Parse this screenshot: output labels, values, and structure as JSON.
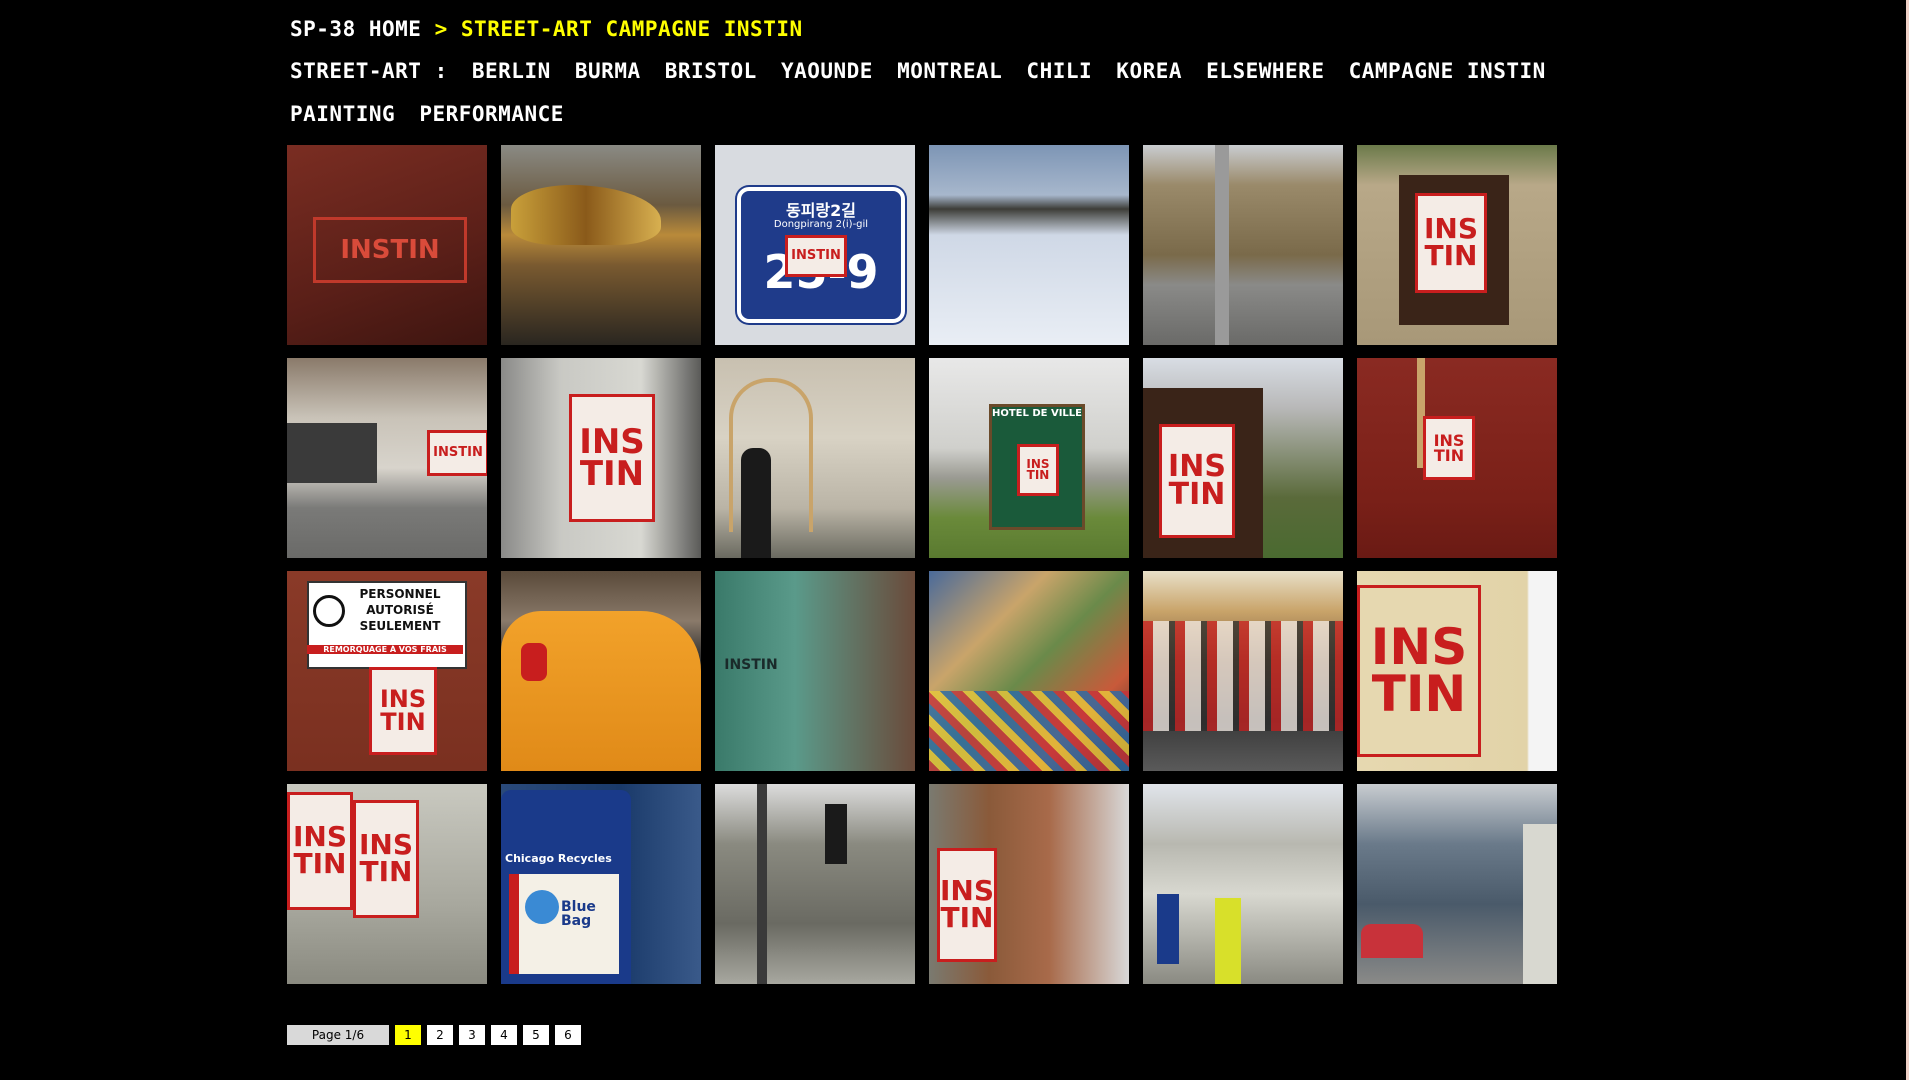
{
  "breadcrumb": {
    "home": "SP-38 HOME",
    "separator": ">",
    "current": "STREET-ART CAMPAGNE INSTIN"
  },
  "nav": {
    "prefix": "STREET-ART :",
    "links": [
      "BERLIN",
      "BURMA",
      "BRISTOL",
      "YAOUNDE",
      "MONTREAL",
      "CHILI",
      "KOREA",
      "ELSEWHERE",
      "CAMPAGNE INSTIN"
    ],
    "line2": [
      "PAINTING",
      "PERFORMANCE"
    ]
  },
  "thumbnails": [
    {
      "tag": "INSTIN"
    },
    {
      "tag": ""
    },
    {
      "tag": "INSTIN"
    },
    {
      "tag": ""
    },
    {
      "tag": ""
    },
    {
      "tag": "INS TIN"
    },
    {
      "tag": ""
    },
    {
      "tag": "INS TIN"
    },
    {
      "tag": ""
    },
    {
      "tag": "INS TIN"
    },
    {
      "tag": "INS TIN"
    },
    {
      "tag": "INS TIN"
    },
    {
      "tag": "INS TIN"
    },
    {
      "tag": ""
    },
    {
      "tag": "INSTIN"
    },
    {
      "tag": ""
    },
    {
      "tag": ""
    },
    {
      "tag": "INS TIN"
    },
    {
      "tag": "INS TIN"
    },
    {
      "tag": ""
    },
    {
      "tag": ""
    },
    {
      "tag": "INS TIN"
    },
    {
      "tag": ""
    },
    {
      "tag": ""
    }
  ],
  "sign_texts": {
    "korean": "동피랑2길",
    "korean_romanized": "Dongpirang 2(i)-gil",
    "korean_number": "25-9",
    "hotel": "HOTEL DE VILLE",
    "parking_1": "PERSONNEL",
    "parking_2": "AUTORISÉ",
    "parking_3": "SEULEMENT",
    "parking_4": "REMORQUAGE À VOS FRAIS",
    "chicago": "Chicago Recycles",
    "blue_bag": "Blue Bag"
  },
  "pager": {
    "info": "Page 1/6",
    "pages": [
      "1",
      "2",
      "3",
      "4",
      "5",
      "6"
    ],
    "active": "1"
  },
  "colors": {
    "accent": "#ffff00",
    "tag_red": "#c81e1e",
    "background": "#000000"
  }
}
